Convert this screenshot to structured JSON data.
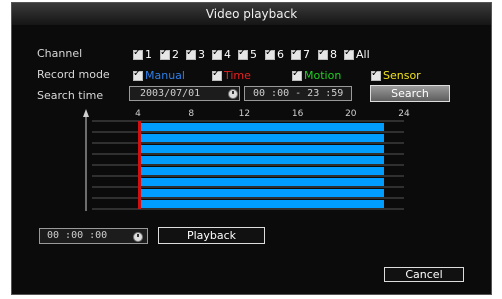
{
  "window": {
    "title": "Video playback"
  },
  "labels": {
    "channel": "Channel",
    "record_mode": "Record mode",
    "search_time": "Search time"
  },
  "channels": [
    "1",
    "2",
    "3",
    "4",
    "5",
    "6",
    "7",
    "8",
    "All"
  ],
  "record_modes": [
    {
      "label": "Manual",
      "color": "#2f7fe8"
    },
    {
      "label": "Time",
      "color": "#e82020"
    },
    {
      "label": "Motion",
      "color": "#22d022"
    },
    {
      "label": "Sensor",
      "color": "#f2e31b"
    }
  ],
  "search": {
    "date": "2003/07/01",
    "time_range": "00 :00 - 23 :59",
    "button": "Search"
  },
  "timeline": {
    "hour_labels": [
      "4",
      "8",
      "12",
      "16",
      "20",
      "24"
    ],
    "bar_color": "#009dff",
    "marker_color": "#d01010",
    "rows": 8
  },
  "playback": {
    "time": "00 :00 :00",
    "button": "Playback"
  },
  "cancel": "Cancel"
}
